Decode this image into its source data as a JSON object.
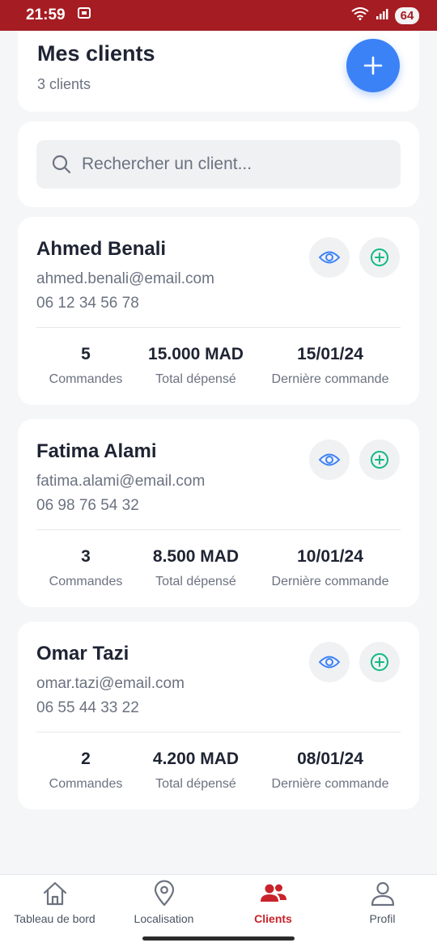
{
  "status_bar": {
    "time": "21:59",
    "battery": "64"
  },
  "header": {
    "title": "Mes clients",
    "subtitle": "3 clients",
    "add_label": "+"
  },
  "search": {
    "placeholder": "Rechercher un client..."
  },
  "stat_labels": {
    "orders": "Commandes",
    "total": "Total dépensé",
    "last": "Dernière commande"
  },
  "clients": [
    {
      "name": "Ahmed Benali",
      "email": "ahmed.benali@email.com",
      "phone": "06 12 34 56 78",
      "orders": "5",
      "total": "15.000 MAD",
      "last_order": "15/01/24"
    },
    {
      "name": "Fatima Alami",
      "email": "fatima.alami@email.com",
      "phone": "06 98 76 54 32",
      "orders": "3",
      "total": "8.500 MAD",
      "last_order": "10/01/24"
    },
    {
      "name": "Omar Tazi",
      "email": "omar.tazi@email.com",
      "phone": "06 55 44 33 22",
      "orders": "2",
      "total": "4.200 MAD",
      "last_order": "08/01/24"
    }
  ],
  "nav": [
    {
      "label": "Tableau de bord",
      "icon": "home-icon"
    },
    {
      "label": "Localisation",
      "icon": "location-pin-icon"
    },
    {
      "label": "Clients",
      "icon": "users-icon",
      "active": true
    },
    {
      "label": "Profil",
      "icon": "user-icon"
    }
  ],
  "colors": {
    "accent": "#3b82f6",
    "brand": "#c8232b",
    "status_bar": "#a51d22",
    "order_green": "#10b981"
  }
}
